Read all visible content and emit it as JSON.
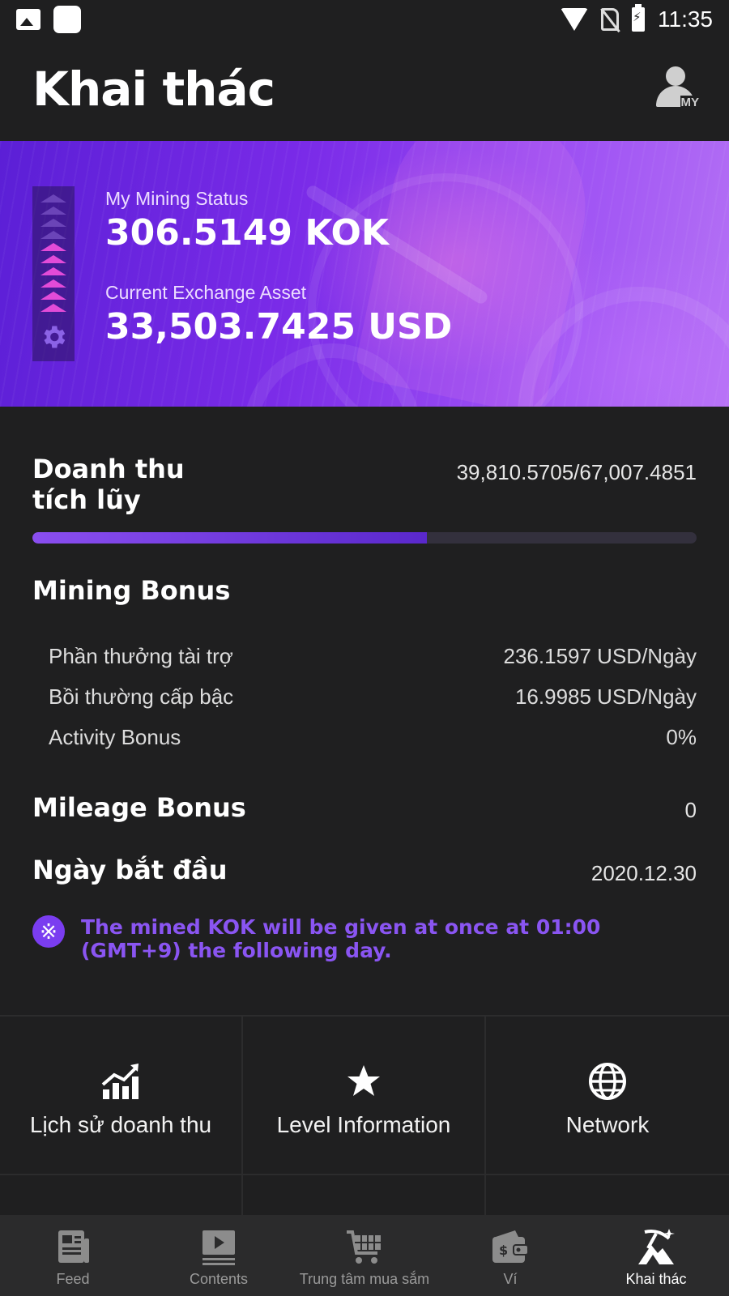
{
  "status_bar": {
    "time": "11:35"
  },
  "header": {
    "title": "Khai thác",
    "profile_badge": "MY"
  },
  "banner": {
    "mining_status_label": "My Mining Status",
    "mining_status_value": "306.5149 KOK",
    "exchange_label": "Current Exchange Asset",
    "exchange_value": "33,503.7425 USD",
    "level_arrows_total": 10,
    "level_arrows_lit": 6
  },
  "revenue": {
    "label": "Doanh thu tích lũy",
    "value": "39,810.5705/67,007.4851",
    "progress_fraction": 0.594
  },
  "mining_bonus": {
    "title": "Mining Bonus",
    "rows": [
      {
        "label": "Phần thưởng tài trợ",
        "value": "236.1597 USD/Ngày"
      },
      {
        "label": "Bồi thường cấp bậc",
        "value": "16.9985 USD/Ngày"
      },
      {
        "label": "Activity Bonus",
        "value": "0%"
      }
    ]
  },
  "mileage_bonus": {
    "title": "Mileage Bonus",
    "value": "0"
  },
  "start_date": {
    "title": "Ngày bắt đầu",
    "value": "2020.12.30"
  },
  "notice": {
    "text": "The mined KOK will be given at once at 01:00 (GMT+9) the following day."
  },
  "menu": [
    {
      "label": "Lịch sử doanh thu",
      "icon": "chart-up-icon"
    },
    {
      "label": "Level Information",
      "icon": "star-icon"
    },
    {
      "label": "Network",
      "icon": "globe-icon"
    }
  ],
  "bottom_nav": [
    {
      "label": "Feed",
      "icon": "newspaper-icon"
    },
    {
      "label": "Contents",
      "icon": "play-icon"
    },
    {
      "label": "Trung tâm mua sắm",
      "icon": "cart-icon"
    },
    {
      "label": "Ví",
      "icon": "wallet-icon"
    },
    {
      "label": "Khai thác",
      "icon": "mining-icon",
      "active": true
    }
  ],
  "colors": {
    "accent": "#7a3df0",
    "notice_text": "#8a55f2",
    "background": "#1f1f20",
    "nav_background": "#2b2b2c"
  }
}
